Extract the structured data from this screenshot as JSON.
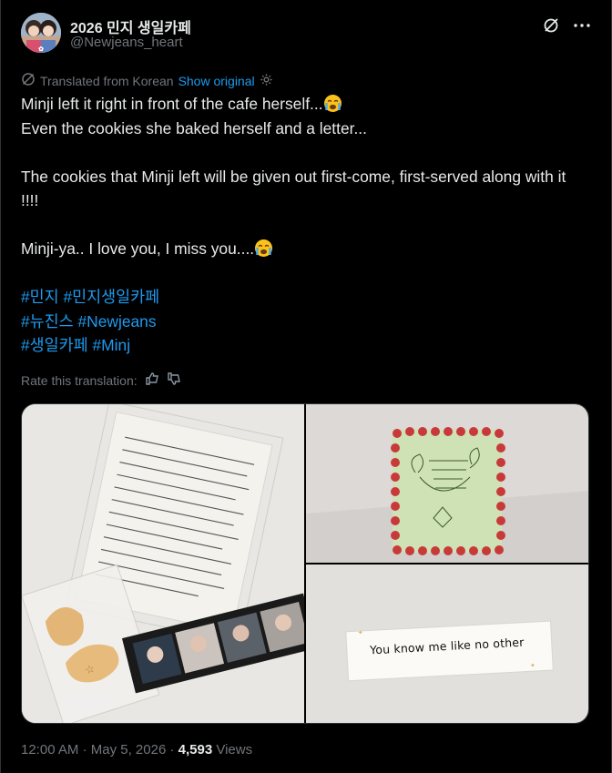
{
  "author": {
    "name": "2026 민지 생일카페",
    "handle": "@Newjeans_heart"
  },
  "header": {
    "grok_icon": "grok-icon",
    "more_icon": "more-icon"
  },
  "translation": {
    "note": "Translated from Korean",
    "show_original": "Show original"
  },
  "post": {
    "line1": "Minji left it right in front of the cafe herself...",
    "line2": "Even the cookies she baked herself and a letter...",
    "line3": "The cookies that Minji left will be given out first-come, first-served along with it !!!!",
    "line4": "Minji-ya.. I love you, I miss you....",
    "hashtags": [
      [
        "#민지",
        "#민지생일카페"
      ],
      [
        "#뉴진스",
        "#Newjeans"
      ],
      [
        "#생일카페",
        "#Minj"
      ]
    ]
  },
  "rate": {
    "label": "Rate this translation:"
  },
  "images": {
    "note_text": "You know me like no other"
  },
  "meta": {
    "time": "12:00 AM",
    "date": "May 5, 2026",
    "views_count": "4,593",
    "views_label": "Views"
  },
  "colors": {
    "accent": "#1d9bf0",
    "muted": "#71767b",
    "bg": "#000000"
  }
}
